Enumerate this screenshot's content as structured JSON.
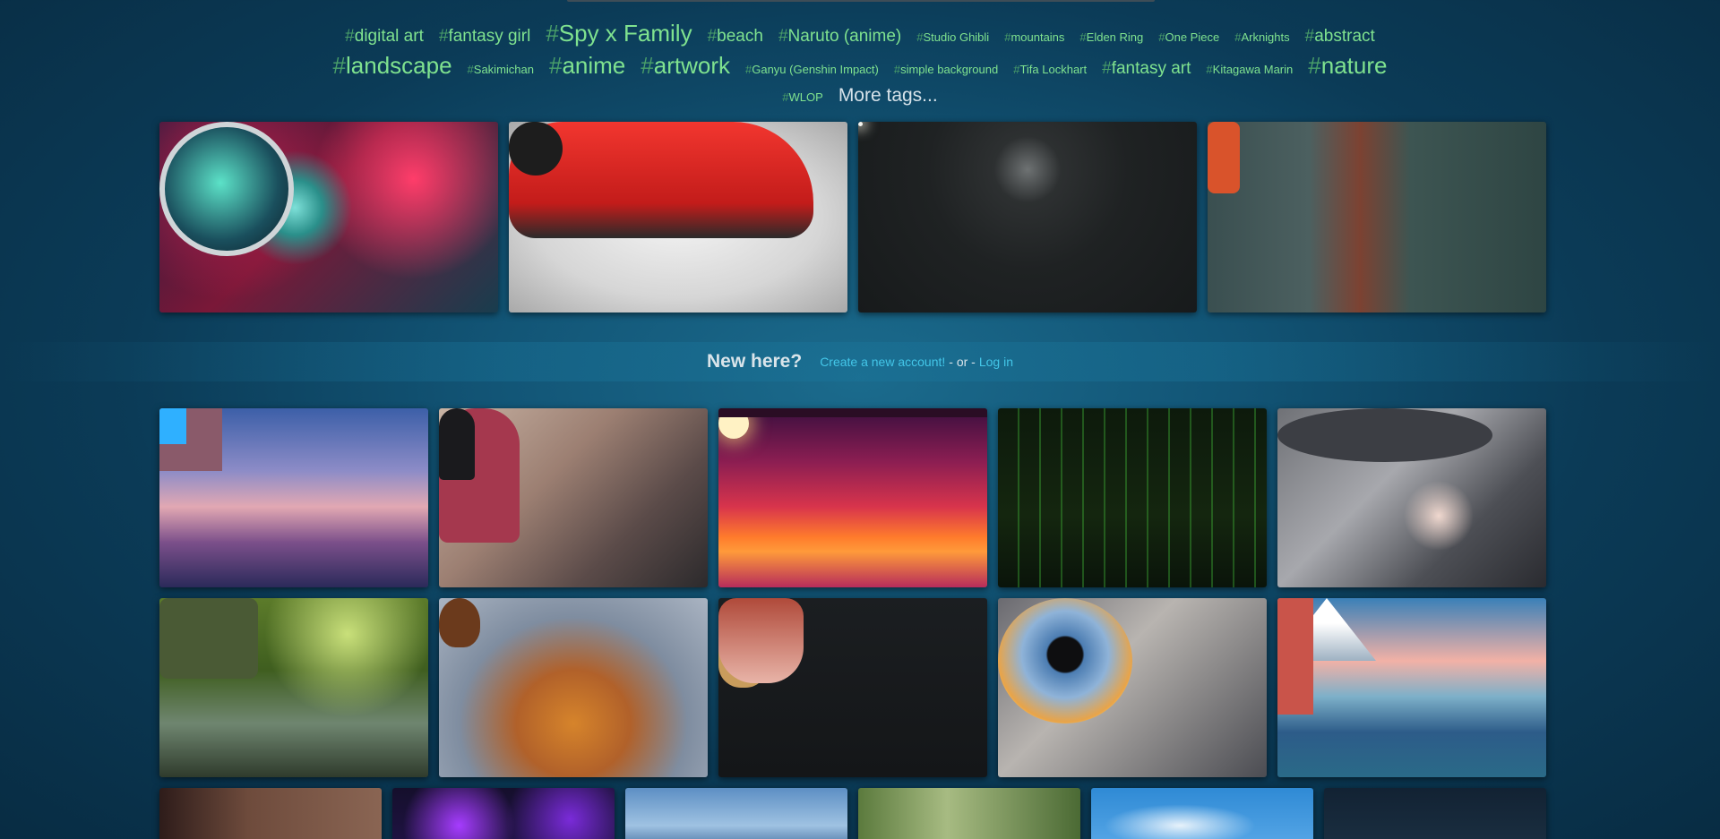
{
  "tags": {
    "row1": [
      {
        "label": "digital art",
        "size": "m"
      },
      {
        "label": "fantasy girl",
        "size": "m"
      },
      {
        "label": "Spy x Family",
        "size": "l"
      },
      {
        "label": "beach",
        "size": "m"
      },
      {
        "label": "Naruto (anime)",
        "size": "m"
      },
      {
        "label": "Studio Ghibli",
        "size": "s"
      },
      {
        "label": "mountains",
        "size": "s"
      },
      {
        "label": "Elden Ring",
        "size": "s"
      },
      {
        "label": "One Piece",
        "size": "s"
      },
      {
        "label": "Arknights",
        "size": "s"
      },
      {
        "label": "abstract",
        "size": "m"
      }
    ],
    "row2": [
      {
        "label": "landscape",
        "size": "l"
      },
      {
        "label": "Sakimichan",
        "size": "s"
      },
      {
        "label": "anime",
        "size": "l"
      },
      {
        "label": "artwork",
        "size": "l"
      },
      {
        "label": "Ganyu (Genshin Impact)",
        "size": "s"
      },
      {
        "label": "simple background",
        "size": "s"
      },
      {
        "label": "Tifa Lockhart",
        "size": "s"
      },
      {
        "label": "fantasy art",
        "size": "m"
      },
      {
        "label": "Kitagawa Marin",
        "size": "s"
      },
      {
        "label": "nature",
        "size": "l"
      }
    ],
    "row3": [
      {
        "label": "WLOP",
        "size": "s"
      }
    ],
    "hash": "#",
    "more_label": "More tags..."
  },
  "featured": [
    {
      "name": "astronaut-helmet-wallpaper"
    },
    {
      "name": "red-ford-gt-wallpaper"
    },
    {
      "name": "dark-street-lamp-wallpaper"
    },
    {
      "name": "anime-girl-hangar-wallpaper"
    }
  ],
  "signup": {
    "question": "New here?",
    "create_label": "Create a new account!",
    "or_label": "- or -",
    "login_label": "Log in"
  },
  "grid": [
    {
      "name": "castle-landscape-wallpaper"
    },
    {
      "name": "girl-with-cat-wallpaper"
    },
    {
      "name": "sunset-wallpaper"
    },
    {
      "name": "green-code-wallpaper"
    },
    {
      "name": "witch-girl-wallpaper"
    },
    {
      "name": "mossy-mill-wallpaper"
    },
    {
      "name": "pinecone-leaves-wallpaper"
    },
    {
      "name": "girl-flowers-wallpaper"
    },
    {
      "name": "eye-closeup-wallpaper"
    },
    {
      "name": "mount-fuji-wallpaper"
    },
    {
      "name": "wallpaper-11"
    },
    {
      "name": "purple-hexagon-wallpaper"
    },
    {
      "name": "blue-sky-wallpaper"
    },
    {
      "name": "forest-wallpaper"
    },
    {
      "name": "blue-sky-clouds-wallpaper"
    },
    {
      "name": "dark-blue-wallpaper"
    }
  ]
}
